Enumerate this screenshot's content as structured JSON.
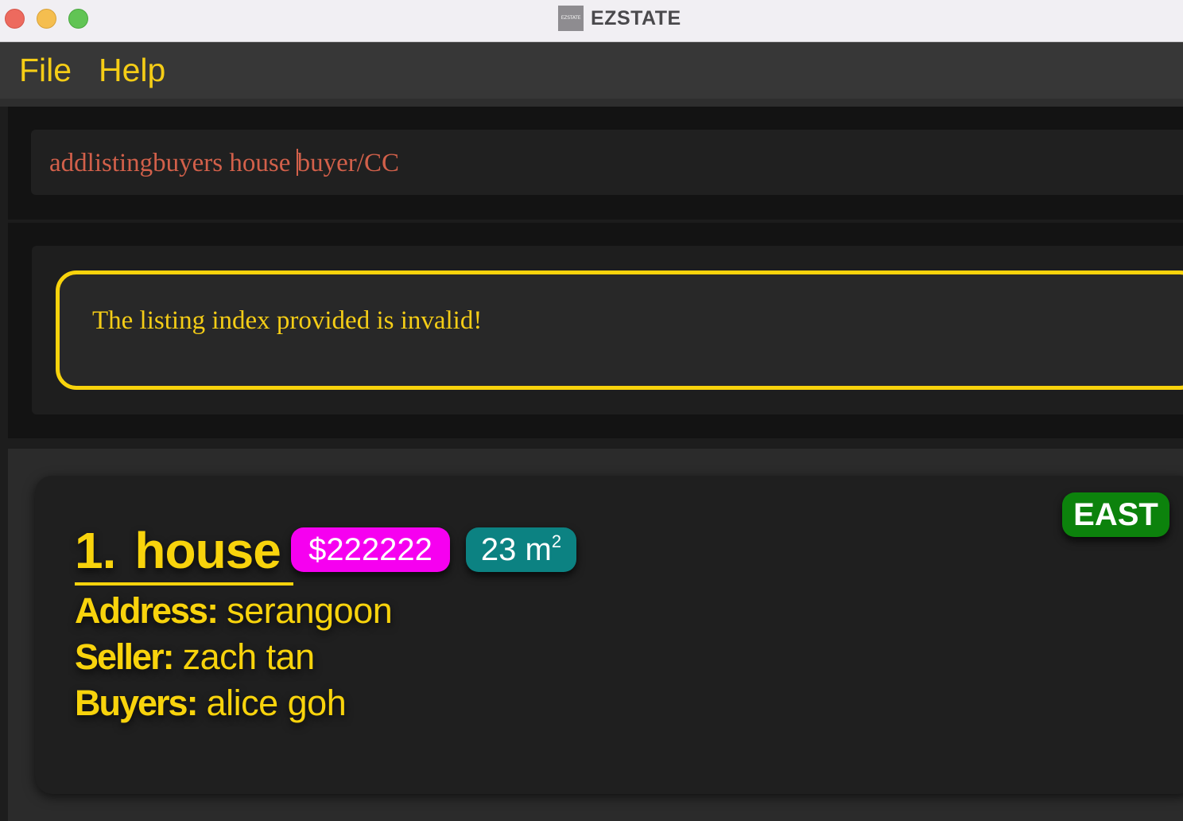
{
  "window": {
    "title": "EZSTATE",
    "icon_text": "EZSTATE"
  },
  "menu": {
    "file": "File",
    "help": "Help"
  },
  "command": {
    "before_caret": "addlistingbuyers house ",
    "after_caret": "buyer/CC"
  },
  "result": {
    "message": "The listing index provided is invalid!"
  },
  "listing": {
    "index": "1.",
    "title": "house",
    "price": "$222222",
    "area_value": "23 m",
    "area_unit_sup": "2",
    "region": "EAST",
    "address_label": "Address:",
    "address": "serangoon",
    "seller_label": "Seller:",
    "seller": "zach tan",
    "buyers_label": "Buyers:",
    "buyers": "alice goh"
  },
  "colors": {
    "accent_yellow": "#f8d30c",
    "command_text": "#d2604a",
    "price_badge": "#f600f0",
    "area_badge": "#0c8282",
    "region_badge": "#0c820c"
  }
}
